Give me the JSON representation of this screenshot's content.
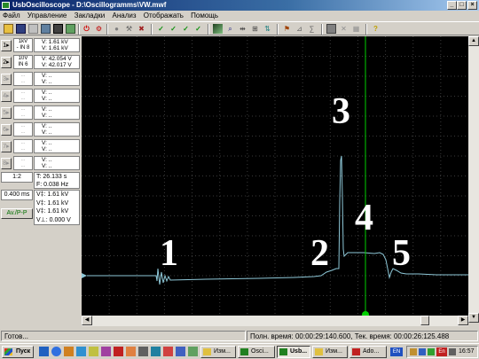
{
  "window": {
    "title": "UsbOscilloscope - D:\\Oscillogramms\\VW.mwf",
    "controls": [
      "_",
      "□",
      "×"
    ]
  },
  "menu": [
    "Файл",
    "Управление",
    "Закладки",
    "Анализ",
    "Отображать",
    "Помощь"
  ],
  "channels": [
    {
      "btn": "1▸",
      "set1": "1kV",
      "set2": "- IN 8",
      "v1": "V: 1.61 kV",
      "v2": "V: 1.61 kV",
      "enabled": true
    },
    {
      "btn": "2▸",
      "set1": "10V",
      "set2": "IN 6",
      "v1": "V: 42.054 V",
      "v2": "V: 42.017 V",
      "enabled": true
    },
    {
      "btn": "3▸",
      "set1": "...",
      "set2": "...",
      "v1": "V:    ..",
      "v2": "V:    ..",
      "enabled": false
    },
    {
      "btn": "4▸",
      "set1": "...",
      "set2": "...",
      "v1": "V:    ..",
      "v2": "V:    ..",
      "enabled": false
    },
    {
      "btn": "5▸",
      "set1": "...",
      "set2": "...",
      "v1": "V:    ..",
      "v2": "V:    ..",
      "enabled": false
    },
    {
      "btn": "6▸",
      "set1": "...",
      "set2": "...",
      "v1": "V:    ..",
      "v2": "V:    ..",
      "enabled": false
    },
    {
      "btn": "7▸",
      "set1": "...",
      "set2": "...",
      "v1": "V:    ..",
      "v2": "V:    ..",
      "enabled": false
    },
    {
      "btn": "8▸",
      "set1": "...",
      "set2": "...",
      "v1": "V:    ..",
      "v2": "V:    ..",
      "enabled": false
    }
  ],
  "timebase": {
    "ratio": "1:2",
    "div": "0.400 ms",
    "mode": "Av./P-P"
  },
  "time_readout": {
    "t": "T: 26.133 s",
    "f": "F: 0.038 Hz"
  },
  "delta_readout": [
    "V‡: 1.61 kV",
    "V‡: 1.61 kV",
    "V‡: 1.61 kV",
    "V⊥: 0.000 V"
  ],
  "annotations": [
    "1",
    "2",
    "3",
    "4",
    "5"
  ],
  "status": {
    "left": "Готов...",
    "right": "Полн. время: 00:00:29:140.600, Тек. время: 00:00:26:125.488"
  },
  "taskbar": {
    "start": "Пуск",
    "tasks": [
      "Изм...",
      "Osci...",
      "Usb...",
      "Изм...",
      "Ado..."
    ],
    "tray_lang": "EN",
    "tray_lang2": "En",
    "clock": "16:57"
  },
  "colors": {
    "trace": "#8ec8d8",
    "cursor": "#00d000",
    "grid": "#2c2c2c",
    "title_start": "#0a246a"
  }
}
